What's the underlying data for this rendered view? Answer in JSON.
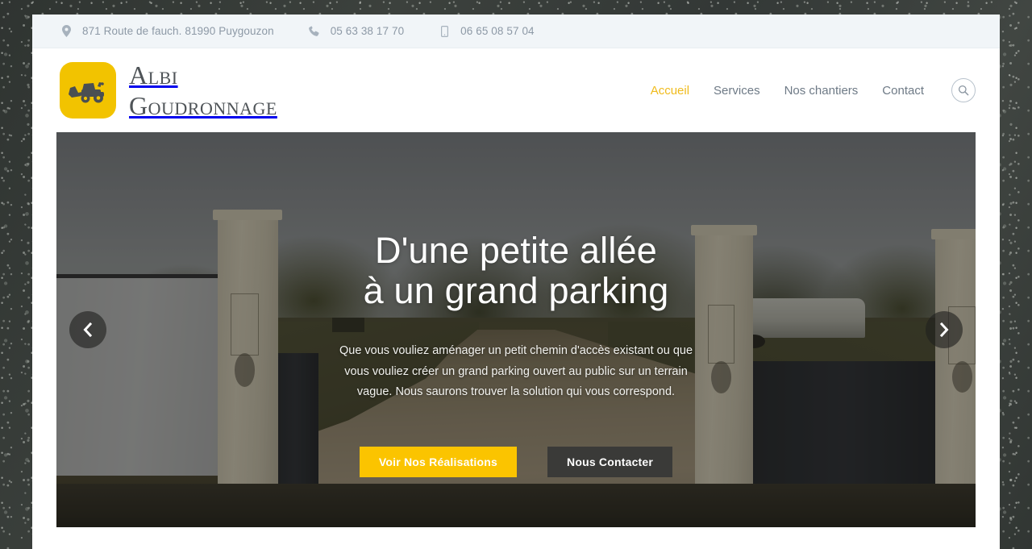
{
  "topbar": {
    "address": "871 Route de fauch. 81990 Puygouzon",
    "phone": "05 63 38 17 70",
    "mobile": "06 65 08 57 04",
    "icons": {
      "address": "map-pin-icon",
      "phone": "phone-icon",
      "mobile": "mobile-phone-icon"
    }
  },
  "brand": {
    "line1": "Albi",
    "line2": "Goudronnage",
    "logo_icon": "bulldozer-icon",
    "logo_bg": "#f2c300"
  },
  "nav": {
    "items": [
      {
        "label": "Accueil",
        "active": true
      },
      {
        "label": "Services",
        "active": false
      },
      {
        "label": "Nos chantiers",
        "active": false
      },
      {
        "label": "Contact",
        "active": false
      }
    ],
    "search_icon": "search-icon",
    "active_color": "#f0bb1c"
  },
  "hero": {
    "title_line1": "D'une petite allée",
    "title_line2": "à un grand parking",
    "paragraph": "Que vous vouliez aménager un petit chemin d'accès existant ou que vous vouliez créer un grand parking ouvert au public sur un terrain vague. Nous saurons trouver la solution qui vous correspond.",
    "primary_button": "Voir Nos Réalisations",
    "secondary_button": "Nous Contacter",
    "primary_color": "#fbc400",
    "secondary_color": "#3a3a38",
    "prev_icon": "chevron-left-icon",
    "next_icon": "chevron-right-icon"
  }
}
